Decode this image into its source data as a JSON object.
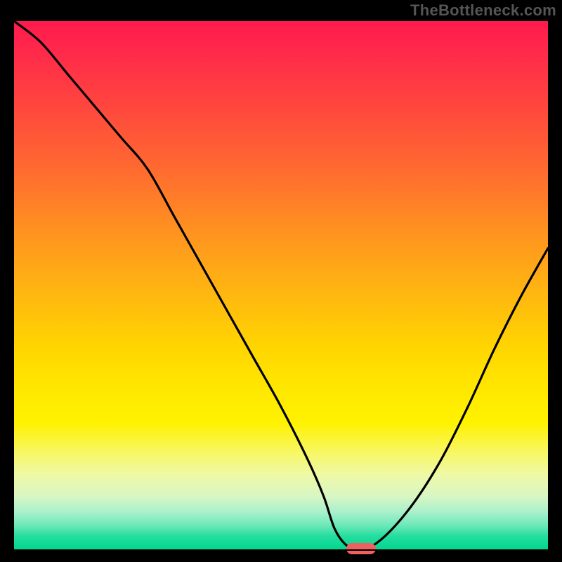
{
  "watermark": "TheBottleneck.com",
  "chart_data": {
    "type": "line",
    "title": "",
    "xlabel": "",
    "ylabel": "",
    "xlim": [
      0,
      100
    ],
    "ylim": [
      0,
      100
    ],
    "grid": false,
    "legend": false,
    "background": "gradient-red-yellow-green-vertical",
    "series": [
      {
        "name": "bottleneck-curve",
        "x": [
          0,
          5,
          10,
          15,
          20,
          25,
          30,
          35,
          40,
          45,
          50,
          55,
          58,
          60,
          62,
          64,
          66,
          70,
          75,
          80,
          85,
          90,
          95,
          100
        ],
        "y": [
          100,
          96,
          90,
          84,
          78,
          72,
          63,
          54,
          45,
          36,
          27,
          17,
          10,
          4,
          1,
          0,
          0,
          3,
          9,
          17,
          27,
          38,
          48,
          57
        ]
      }
    ],
    "marker": {
      "x": 65,
      "y": 0,
      "shape": "pill",
      "color": "#ef6060"
    }
  }
}
